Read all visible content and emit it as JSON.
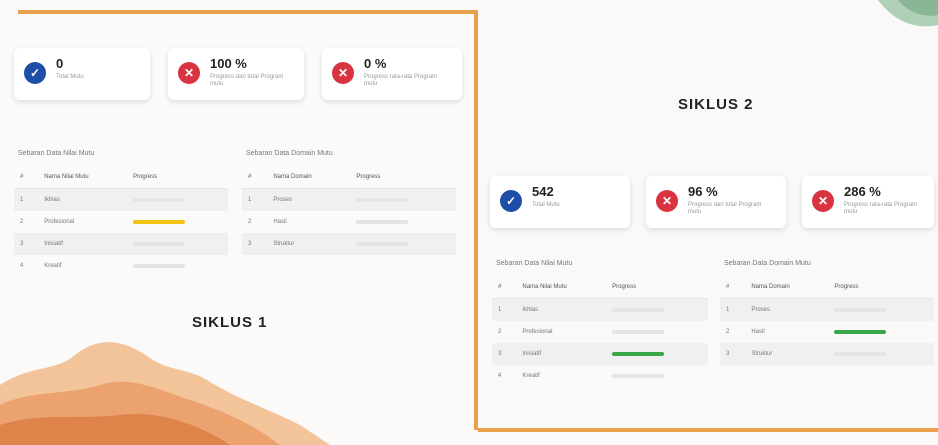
{
  "siklus1": {
    "label": "SIKLUS 1",
    "cards": [
      {
        "value": "0",
        "label": "Total Mutu",
        "icon": "check-icon",
        "color": "#1d4fa8"
      },
      {
        "value": "100 %",
        "label": "Progress dari total Program mutu",
        "icon": "x-icon",
        "color": "#d8333f"
      },
      {
        "value": "0 %",
        "label": "Progress rata-rata Program mutu",
        "icon": "x-icon",
        "color": "#d8333f"
      }
    ],
    "table_left": {
      "title": "Sebaran Data Nilai Mutu",
      "headers": [
        "#",
        "Nama Nilai Mutu",
        "Progress"
      ],
      "rows": [
        {
          "no": "1",
          "name": "Ikhlas",
          "progress": 0,
          "color": "#e0e0e0"
        },
        {
          "no": "2",
          "name": "Profesional",
          "progress": 1,
          "color": "#f2c311"
        },
        {
          "no": "3",
          "name": "Inisiatif",
          "progress": 0,
          "color": "#e0e0e0"
        },
        {
          "no": "4",
          "name": "Kreatif",
          "progress": 0,
          "color": "#e0e0e0"
        }
      ]
    },
    "table_right": {
      "title": "Sebaran Data Domain Mutu",
      "headers": [
        "#",
        "Nama Domain",
        "Progress"
      ],
      "rows": [
        {
          "no": "1",
          "name": "Proses",
          "progress": 0,
          "color": "#e0e0e0"
        },
        {
          "no": "2",
          "name": "Hasil",
          "progress": 0,
          "color": "#e0e0e0"
        },
        {
          "no": "3",
          "name": "Struktur",
          "progress": 0,
          "color": "#e0e0e0"
        }
      ]
    }
  },
  "siklus2": {
    "label": "SIKLUS 2",
    "cards": [
      {
        "value": "542",
        "label": "Total Mutu",
        "icon": "check-icon",
        "color": "#1d4fa8"
      },
      {
        "value": "96 %",
        "label": "Progress dari total Program mutu",
        "icon": "x-icon",
        "color": "#d8333f"
      },
      {
        "value": "286 %",
        "label": "Progress rata-rata Program mutu",
        "icon": "x-icon",
        "color": "#d8333f"
      }
    ],
    "table_left": {
      "title": "Sebaran Data Nilai Mutu",
      "headers": [
        "#",
        "Nama Nilai Mutu",
        "Progress"
      ],
      "rows": [
        {
          "no": "1",
          "name": "Ikhlas",
          "progress": 0,
          "color": "#e0e0e0"
        },
        {
          "no": "2",
          "name": "Profesional",
          "progress": 0,
          "color": "#e0e0e0"
        },
        {
          "no": "3",
          "name": "Inisiatif",
          "progress": 1,
          "color": "#3aa64a"
        },
        {
          "no": "4",
          "name": "Kreatif",
          "progress": 0,
          "color": "#e0e0e0"
        }
      ]
    },
    "table_right": {
      "title": "Sebaran Data Domain Mutu",
      "headers": [
        "#",
        "Nama Domain",
        "Progress"
      ],
      "rows": [
        {
          "no": "1",
          "name": "Proses",
          "progress": 0,
          "color": "#e0e0e0"
        },
        {
          "no": "2",
          "name": "Hasil",
          "progress": 1,
          "color": "#3aa64a"
        },
        {
          "no": "3",
          "name": "Struktur",
          "progress": 0,
          "color": "#e0e0e0"
        }
      ]
    }
  },
  "accent": "#eaa04c"
}
